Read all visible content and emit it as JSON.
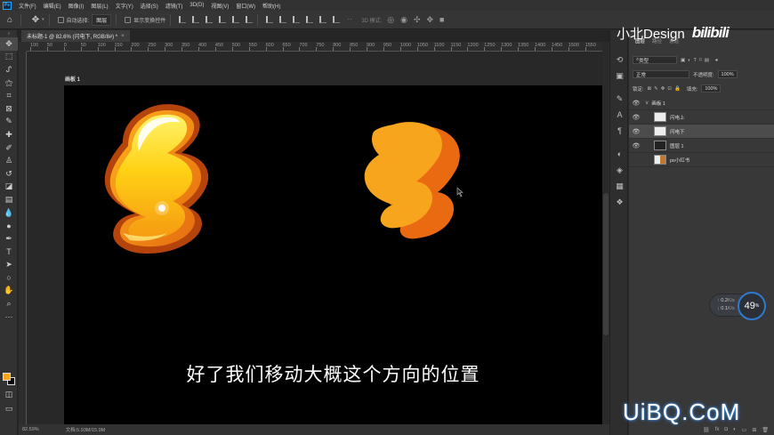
{
  "menu": [
    "文件(F)",
    "编辑(E)",
    "图像(I)",
    "图层(L)",
    "文字(Y)",
    "选择(S)",
    "滤镜(T)",
    "3D(D)",
    "视图(V)",
    "窗口(W)",
    "帮助(H)"
  ],
  "options": {
    "auto_select_label": "自动选择:",
    "auto_select_value": "图层",
    "show_transform_label": "显示变换控件",
    "mode_3d_label": "3D 模式:"
  },
  "document_tab": {
    "title": "未标题-1 @ 82.6% (闪电下, RGB/8#) *",
    "close": "×"
  },
  "ruler_labels": [
    "100",
    "50",
    "0",
    "50",
    "100",
    "150",
    "200",
    "250",
    "300",
    "350",
    "400",
    "450",
    "500",
    "550",
    "600",
    "650",
    "700",
    "750",
    "800",
    "850",
    "900",
    "950",
    "1000",
    "1050",
    "1100",
    "1150",
    "1200",
    "1250",
    "1300",
    "1350",
    "1400",
    "1450",
    "1500",
    "1550",
    "1600"
  ],
  "artboard": {
    "label": "画板 1"
  },
  "subtitle": "好了我们移动大概这个方向的位置",
  "status": {
    "zoom": "82.59%",
    "doc_size": "文档:5.93M/15.9M"
  },
  "watermark_top": {
    "text": "小北Design",
    "logo": "bilibili"
  },
  "layers_panel": {
    "tabs": [
      "图层",
      "路径",
      "通道"
    ],
    "filter_label": "类型",
    "blend_mode": "正常",
    "opacity_label": "不透明度:",
    "opacity_value": "100%",
    "lock_label": "锁定:",
    "fill_label": "填充:",
    "fill_value": "100%",
    "layers": [
      {
        "name": "画板 1",
        "type": "group"
      },
      {
        "name": "闪电上",
        "type": "layer"
      },
      {
        "name": "闪电下",
        "type": "layer"
      },
      {
        "name": "图层 1",
        "type": "layer"
      },
      {
        "name": "ps小红书",
        "type": "layer"
      }
    ]
  },
  "network_widget": {
    "upload": "0.2",
    "download": "0.1",
    "unit": "K/s",
    "percent": "49",
    "percent_sign": "%"
  },
  "watermark_bottom": "UiBQ.CoM",
  "colors": {
    "foreground": "#f7a51c",
    "background": "#000000",
    "bolt_top": "#ffd21f",
    "bolt_bottom": "#f39a1c"
  }
}
